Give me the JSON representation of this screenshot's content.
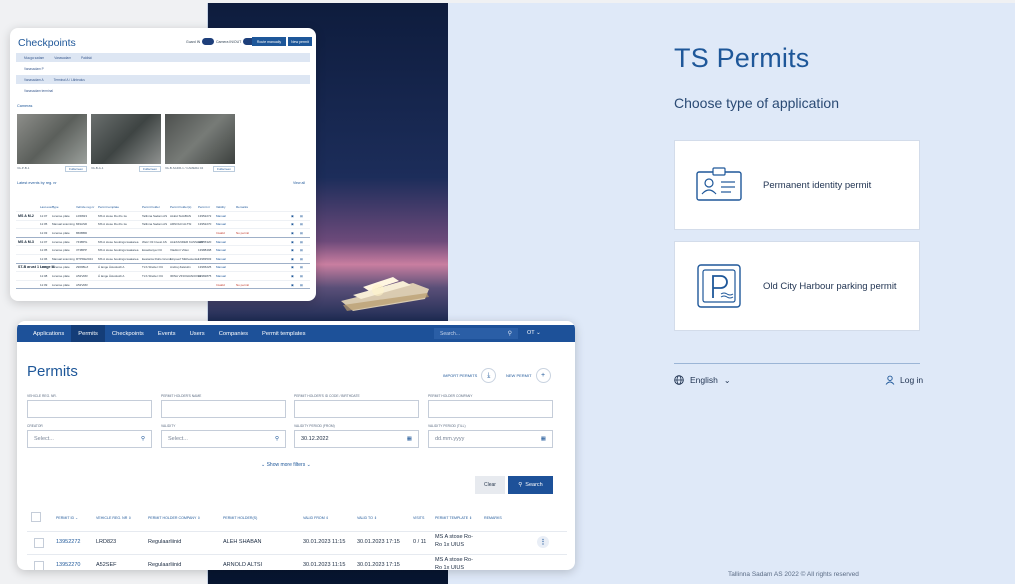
{
  "login": {
    "title": "TS Permits",
    "subtitle": "Choose type of application",
    "options": [
      {
        "label": "Permanent identity permit",
        "icon": "id-card-icon"
      },
      {
        "label": "Old City Harbour parking permit",
        "icon": "parking-icon"
      }
    ],
    "language": "English",
    "login_label": "Log in",
    "footer": "Tallinna Sadam AS 2022 © All rights reserved"
  },
  "checkpoints": {
    "title": "Checkpoints",
    "toggle1": "Guard IN",
    "toggle2": "Camera IN/OUT",
    "btn1": "Route manually",
    "btn2": "New permit",
    "filter1": [
      "Muuga sadam",
      "Vanasadam",
      "Paldiski"
    ],
    "filter2": "Vanasadam P",
    "filter3": [
      "Vanasadam A",
      "Terminal A / Lähtealus"
    ],
    "filter4": "Vanasadam terminal",
    "cameras_label": "Cameras",
    "cameras": [
      {
        "name": "VA-P-B-1",
        "action": "Fullscreen"
      },
      {
        "name": "VA-B-A-1",
        "action": "Fullscreen"
      },
      {
        "name": "VA-B-SADR-1 / CAMERA 04",
        "action": "Fullscreen"
      }
    ],
    "events_label": "Latest events by reg. nr",
    "view_all": "View all",
    "headers": [
      "Last event",
      "Type",
      "Vehicle reg.nr",
      "Permit template",
      "Permit holder",
      "Permit holder(s)",
      "Permit nr",
      "Validity",
      "Remarks"
    ],
    "groups": [
      {
        "name": "MS A M-2",
        "rows": [
          [
            "11:07",
            "License plate",
            "LRD823",
            "MS A stose Ro-Ro 1a",
            "Tallinna Sadam AS",
            "ALEH SHABAN",
            "13952272",
            "Manual",
            ""
          ],
          [
            "11:05",
            "Manual scanning",
            "849ASD",
            "MS A stose Ro-Ro 1a",
            "Tallinna Sadam AS",
            "ARNOLD ALTSI",
            "13952270",
            "Manual",
            ""
          ],
          [
            "11:03",
            "License plate",
            "866BBD",
            "",
            "",
            "",
            "",
            "Invalid",
            "No permit"
          ]
        ]
      },
      {
        "name": "MS A M-3",
        "rows": [
          [
            "11:07",
            "License plate",
            "743BPG",
            "MS A stose bookings kaatarea",
            "Wetz Oil Invest AS",
            "ALEXANDER KASSLER",
            "13955320",
            "Manual",
            ""
          ],
          [
            "11:05",
            "License plate",
            "373BPP",
            "MS A stose bookings kaatarea",
            "Esseltanya OU",
            "Vladimir Viilen",
            "13988498",
            "Manual",
            ""
          ],
          [
            "11:06",
            "Manual scanning",
            "RTPDE2024",
            "MS A stose bookings kaatarea",
            "Eestanta Rollo Grund",
            "Einpoerf Mikhestenko",
            "13983503",
            "Manual",
            ""
          ]
        ]
      },
      {
        "name": "ST-B arust 1 Lange M",
        "rows": [
          [
            "11:07",
            "License plate",
            "2969BLZ",
            "Á lange Ästoskolli A",
            "TLS Shelter OU",
            "Andrej Zaistulin",
            "13965225",
            "Manual",
            ""
          ],
          [
            "11:08",
            "License plate",
            "A52VRR",
            "Á lange Ästoskolli A",
            "TLS Shelter OU",
            "IRINA VINOGRADOVA",
            "13982875",
            "Manual",
            ""
          ],
          [
            "11:09",
            "License plate",
            "A52VRR",
            "",
            "",
            "",
            "",
            "Invalid",
            "No permit"
          ]
        ]
      }
    ]
  },
  "permits": {
    "nav": [
      "Applications",
      "Permits",
      "Checkpoints",
      "Events",
      "Users",
      "Companies",
      "Permit templates"
    ],
    "search_placeholder": "Search...",
    "lang": "OT",
    "title": "Permits",
    "import_label": "IMPORT PERMITS",
    "new_label": "NEW PERMIT",
    "filters": {
      "vehicle_reg_label": "VEHICLE REG. NR.",
      "holder_name_label": "PERMIT HOLDER'S NAME",
      "holder_id_label": "PERMIT HOLDER'S ID CODE / BIRTHDATE",
      "holder_company_label": "PERMIT HOLDER COMPANY",
      "creator_label": "CREATOR",
      "creator_value": "Select...",
      "validity_label": "VALIDITY",
      "validity_value": "Select...",
      "from_label": "VALIDITY PERIOD (FROM)",
      "from_value": "30.12.2022",
      "till_label": "VALIDITY PERIOD (TILL)",
      "till_value": "dd.mm.yyyy"
    },
    "more_filters": "Show more filters",
    "clear": "Clear",
    "search": "Search",
    "columns": [
      "PERMIT ID",
      "VEHICLE REG. NR",
      "PERMIT HOLDER COMPANY",
      "PERMIT HOLDER(S)",
      "VALID FROM",
      "VALID TO",
      "VISITS",
      "PERMIT TEMPLATE",
      "REMARKS"
    ],
    "rows": [
      {
        "id": "13952272",
        "reg": "LRD823",
        "company": "Regulaarliinid",
        "holder": "ALEH SHABAN",
        "from": "30.01.2023 11:15",
        "to": "30.01.2023 17:15",
        "visits": "0 / 11",
        "template": "MS A stose Ro-Ro 1x UIUS"
      },
      {
        "id": "13952270",
        "reg": "A52SEF",
        "company": "Regulaarliinid",
        "holder": "ARNOLD ALTSI",
        "from": "30.01.2023 11:15",
        "to": "30.01.2023 17:15",
        "visits": "0 / 11",
        "template": "MS A stose Ro-Ro 1x UIUS"
      }
    ]
  }
}
